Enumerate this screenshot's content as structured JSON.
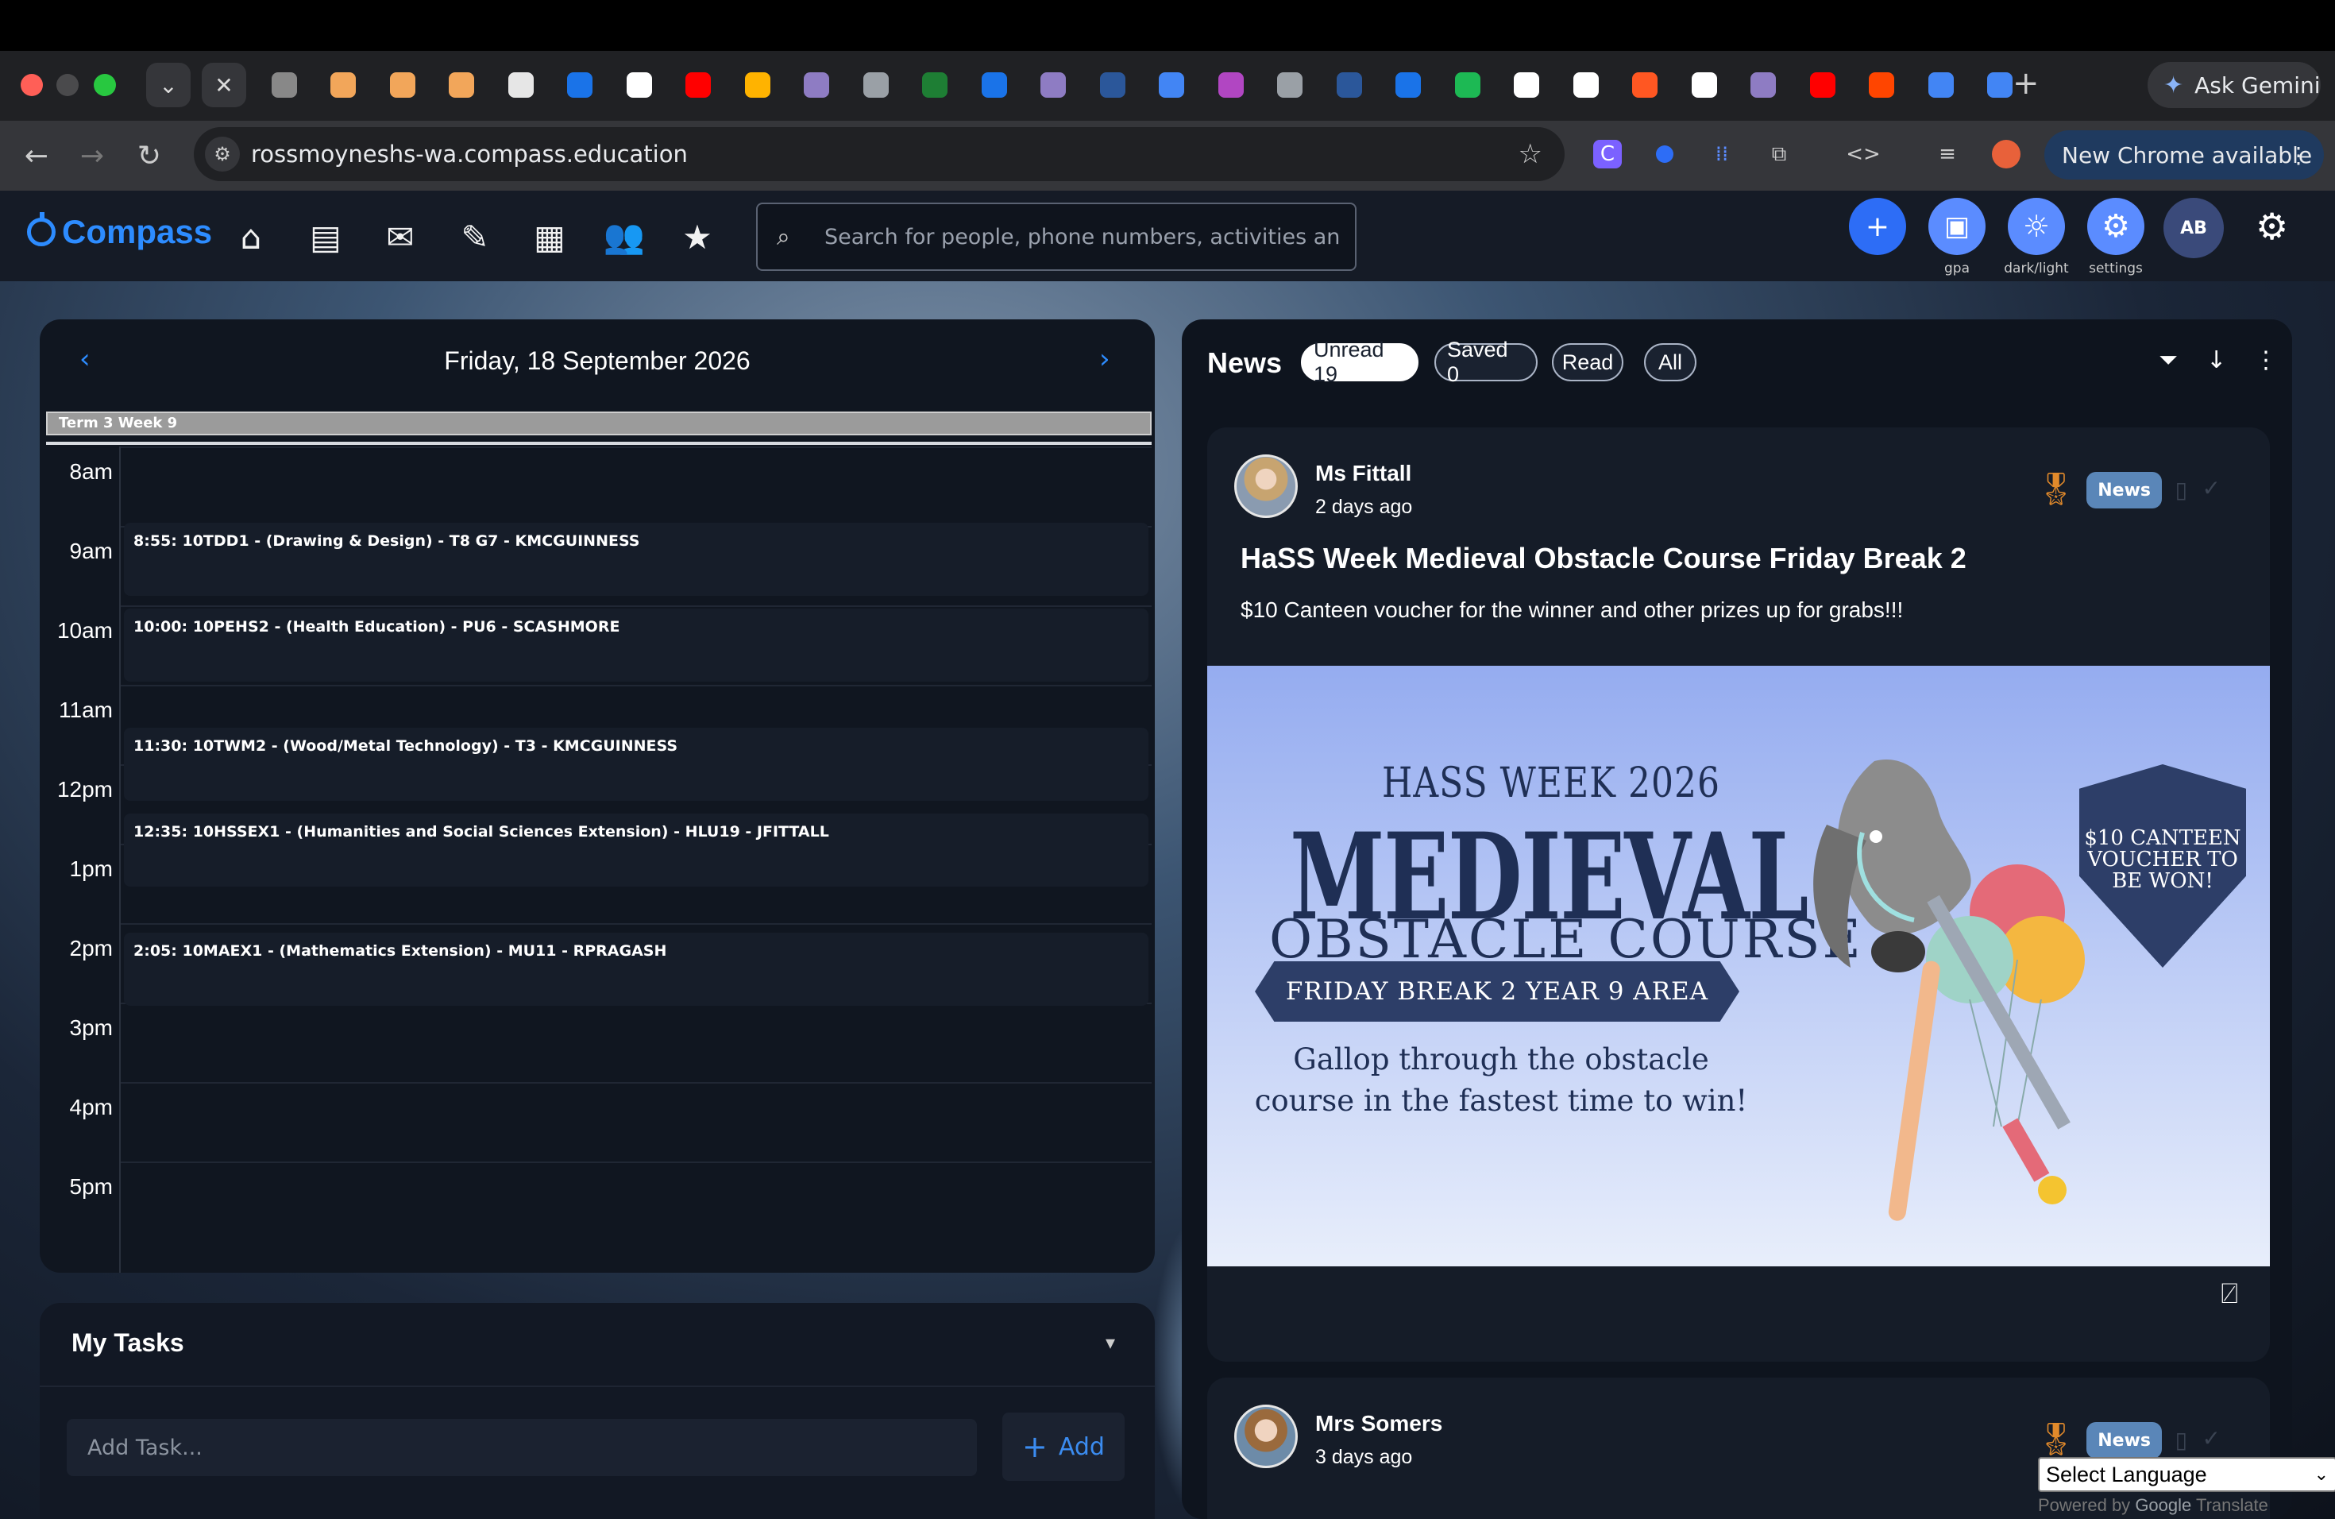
{
  "browser": {
    "url": "rossmoyneshs-wa.compass.education",
    "ask_gemini": "Ask Gemini",
    "update_label": "New Chrome available",
    "tab_colors": [
      "#888888",
      "#f2a65a",
      "#f2a65a",
      "#f2a65a",
      "#e6e6e6",
      "#1a73e8",
      "#ffffff",
      "#ff0000",
      "#ffb300",
      "#8e7cc3",
      "#9aa0a6",
      "#1e7e34",
      "#1a73e8",
      "#8e7cc3",
      "#2b579a",
      "#4285f4",
      "#b146c2",
      "#9aa0a6",
      "#2b579a",
      "#1a73e8",
      "#1db954",
      "#ffffff",
      "#ffffff",
      "#ff5722",
      "#ffffff",
      "#8e7cc3",
      "#ff0000",
      "#ff4500",
      "#4285f4",
      "#4285f4"
    ]
  },
  "compass": {
    "brand": "Compass",
    "search_placeholder": "Search for people, phone numbers, activities and more..",
    "buttons": {
      "add": "+",
      "gpa": "gpa",
      "dark_light": "dark/light",
      "settings": "settings",
      "avatar": "AB"
    }
  },
  "calendar": {
    "date": "Friday, 18 September 2026",
    "term": "Term 3 Week 9",
    "hours": [
      "8am",
      "9am",
      "10am",
      "11am",
      "12pm",
      "1pm",
      "2pm",
      "3pm",
      "4pm",
      "5pm"
    ],
    "events": [
      "8:55: 10TDD1 - (Drawing & Design) - T8 G7 - KMCGUINNESS",
      "10:00: 10PEHS2 - (Health Education) - PU6 - SCASHMORE",
      "11:30: 10TWM2 - (Wood/Metal Technology) - T3 - KMCGUINNESS",
      "12:35: 10HSSEX1 - (Humanities and Social Sciences Extension) - HLU19 - JFITTALL",
      "2:05: 10MAEX1 - (Mathematics Extension) - MU11 - RPRAGASH"
    ]
  },
  "tasks": {
    "title": "My Tasks",
    "placeholder": "Add Task...",
    "add_label": "Add"
  },
  "news": {
    "title": "News",
    "filters": [
      "Unread 19",
      "Saved 0",
      "Read",
      "All"
    ],
    "items": [
      {
        "author": "Ms Fittall",
        "time": "2 days ago",
        "badge": "News",
        "headline": "HaSS Week Medieval Obstacle Course Friday Break 2",
        "body": "$10 Canteen voucher for the winner and other prizes up for grabs!!!",
        "poster": {
          "line1": "HASS WEEK 2026",
          "line2": "MEDIEVAL",
          "line3": "OBSTACLE COURSE",
          "band": "FRIDAY BREAK 2 YEAR 9 AREA",
          "sub": "Gallop through the obstacle course in the fastest time to win!",
          "shield": "$10 CANTEEN VOUCHER TO BE WON!"
        }
      },
      {
        "author": "Mrs Somers",
        "time": "3 days ago",
        "badge": "News"
      }
    ]
  },
  "translate": {
    "select": "Select Language",
    "powered": "Powered by",
    "google": "Google",
    "translate": "Translate"
  }
}
